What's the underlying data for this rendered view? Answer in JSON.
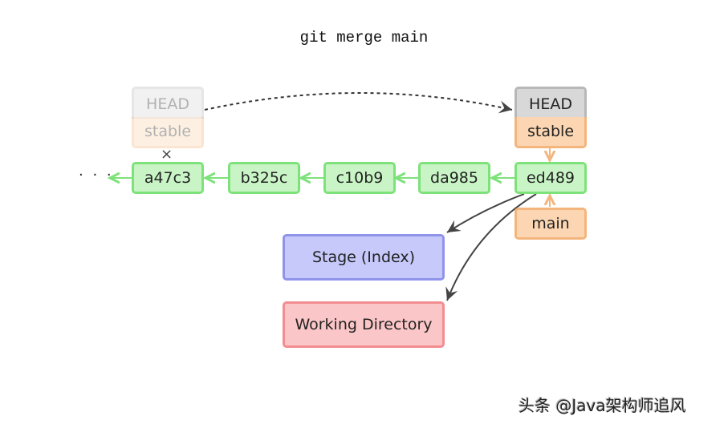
{
  "title": "git merge main",
  "commits": [
    {
      "id": "a47c3"
    },
    {
      "id": "b325c"
    },
    {
      "id": "c10b9"
    },
    {
      "id": "da985"
    },
    {
      "id": "ed489"
    }
  ],
  "ellipsis": "· · ·",
  "old_refs": {
    "head": "HEAD",
    "branch": "stable",
    "detached_mark": "×"
  },
  "new_refs": {
    "head": "HEAD",
    "branch": "stable",
    "main": "main"
  },
  "areas": {
    "stage": "Stage (Index)",
    "working_directory": "Working Directory"
  },
  "colors": {
    "commit_fill": "#c9f5c6",
    "commit_border": "#7de27a",
    "branch_fill": "#fcd6b2",
    "branch_border": "#f4b57c",
    "head_fill": "#d8d8d8",
    "head_border": "#b8b8b8",
    "stage_fill": "#c7c9fb",
    "stage_border": "#8f93ea",
    "wd_fill": "#fbc6c7",
    "wd_border": "#f28d91"
  },
  "watermark": "头条 @Java架构师追风"
}
